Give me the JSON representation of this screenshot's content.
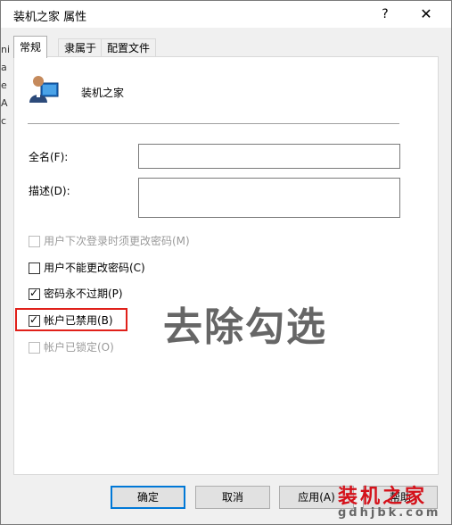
{
  "window": {
    "title": "装机之家 属性",
    "help_label": "?",
    "close_label": "✕"
  },
  "background_fragment": [
    "ni",
    "a",
    "e",
    "A",
    "c"
  ],
  "tabs": [
    {
      "label": "常规",
      "active": true
    },
    {
      "label": "隶属于",
      "active": false
    },
    {
      "label": "配置文件",
      "active": false
    }
  ],
  "general": {
    "user_name": "装机之家",
    "fullname_label": "全名(F):",
    "fullname_value": "",
    "description_label": "描述(D):",
    "description_value": ""
  },
  "checkboxes": [
    {
      "label": "用户下次登录时须更改密码(M)",
      "checked": false,
      "disabled": true
    },
    {
      "label": "用户不能更改密码(C)",
      "checked": false,
      "disabled": false
    },
    {
      "label": "密码永不过期(P)",
      "checked": true,
      "disabled": false
    },
    {
      "label": "帐户已禁用(B)",
      "checked": true,
      "disabled": false
    },
    {
      "label": "帐户已锁定(O)",
      "checked": false,
      "disabled": true
    }
  ],
  "annotation": {
    "overlay_text": "去除勾选",
    "highlight_color": "#e0201a"
  },
  "buttons": {
    "ok": "确定",
    "cancel": "取消",
    "apply": "应用(A)",
    "help": "帮助"
  },
  "watermark": {
    "text": "装机之家",
    "url": "gdhjbk.com",
    "color": "#d4111a"
  }
}
